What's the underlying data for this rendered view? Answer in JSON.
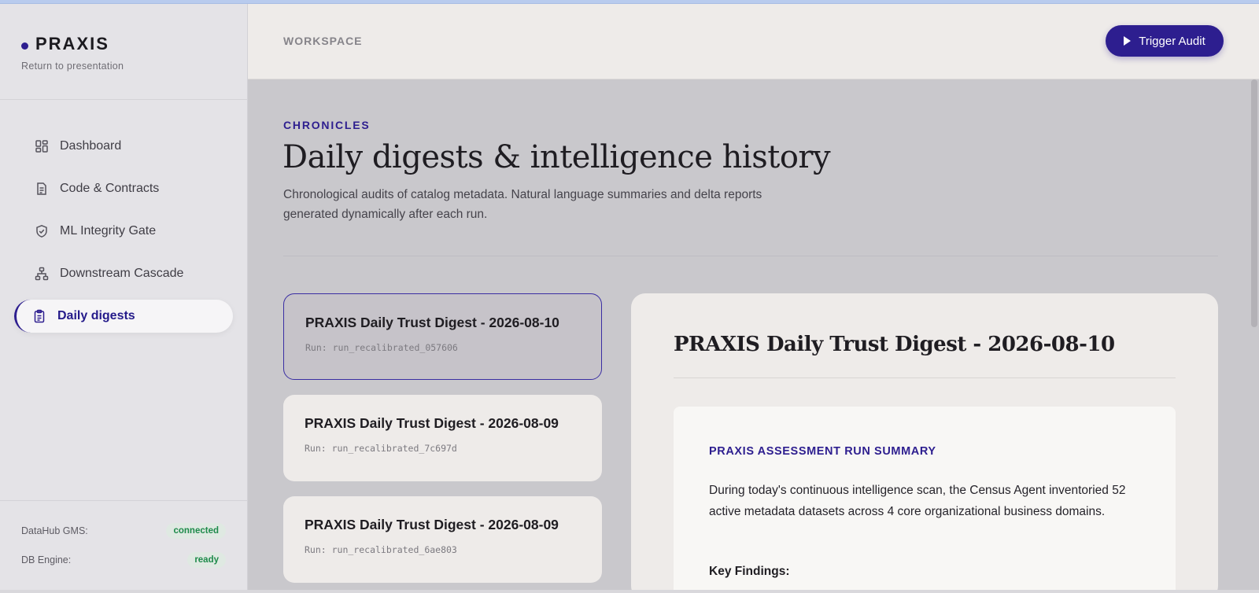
{
  "brand": {
    "name": "PRAXIS",
    "subtitle": "Return to presentation"
  },
  "sidebar": {
    "items": [
      {
        "label": "Dashboard",
        "icon": "dashboard-icon"
      },
      {
        "label": "Code & Contracts",
        "icon": "document-icon"
      },
      {
        "label": "ML Integrity Gate",
        "icon": "shield-check-icon"
      },
      {
        "label": "Downstream Cascade",
        "icon": "hierarchy-icon"
      },
      {
        "label": "Daily digests",
        "icon": "clipboard-icon",
        "active": true
      }
    ],
    "status": [
      {
        "label": "DataHub GMS:",
        "value": "connected"
      },
      {
        "label": "DB Engine:",
        "value": "ready"
      }
    ]
  },
  "header": {
    "section": "WORKSPACE",
    "action_label": "Trigger Audit"
  },
  "main": {
    "eyebrow": "CHRONICLES",
    "title": "Daily digests & intelligence history",
    "description": "Chronological audits of catalog metadata. Natural language summaries and delta reports generated dynamically after each run."
  },
  "digests": [
    {
      "title": "PRAXIS Daily Trust Digest - 2026-08-10",
      "run": "Run: run_recalibrated_057606",
      "selected": true
    },
    {
      "title": "PRAXIS Daily Trust Digest - 2026-08-09",
      "run": "Run: run_recalibrated_7c697d"
    },
    {
      "title": "PRAXIS Daily Trust Digest - 2026-08-09",
      "run": "Run: run_recalibrated_6ae803"
    }
  ],
  "detail": {
    "title": "PRAXIS Daily Trust Digest - 2026-08-10",
    "summary_heading": "PRAXIS ASSESSMENT RUN SUMMARY",
    "summary_text": "During today's continuous intelligence scan, the Census Agent inventoried 52 active metadata datasets across 4 core organizational business domains.",
    "key_findings_label": "Key Findings:"
  },
  "colors": {
    "accent": "#2d1e8f",
    "success": "#1d8a4a"
  }
}
